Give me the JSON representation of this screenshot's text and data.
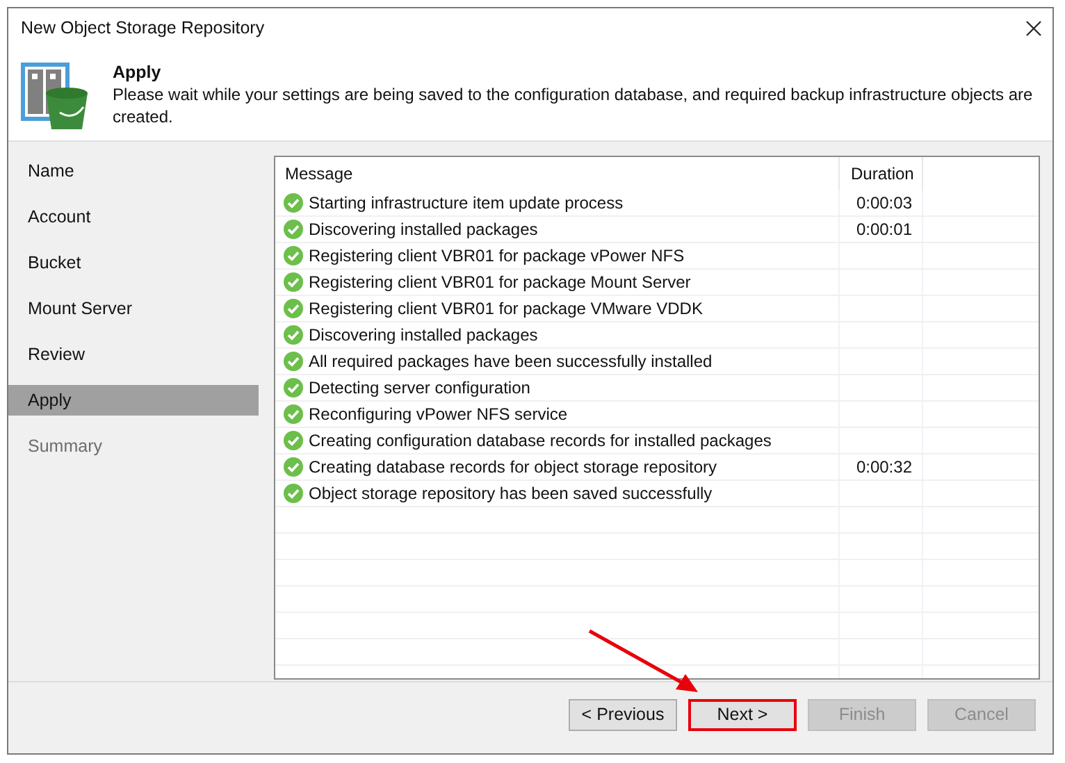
{
  "window": {
    "title": "New Object Storage Repository"
  },
  "header": {
    "title": "Apply",
    "description": "Please wait while your settings are being saved to the configuration database, and required backup infrastructure objects are created."
  },
  "steps": [
    {
      "label": "Name",
      "selected": false,
      "disabled": false
    },
    {
      "label": "Account",
      "selected": false,
      "disabled": false
    },
    {
      "label": "Bucket",
      "selected": false,
      "disabled": false
    },
    {
      "label": "Mount Server",
      "selected": false,
      "disabled": false
    },
    {
      "label": "Review",
      "selected": false,
      "disabled": false
    },
    {
      "label": "Apply",
      "selected": true,
      "disabled": false
    },
    {
      "label": "Summary",
      "selected": false,
      "disabled": true
    }
  ],
  "table": {
    "columns": [
      "Message",
      "Duration"
    ],
    "rows": [
      {
        "succeeded": true,
        "message": "Starting infrastructure item update process",
        "duration": "0:00:03"
      },
      {
        "succeeded": true,
        "message": "Discovering installed packages",
        "duration": "0:00:01"
      },
      {
        "succeeded": true,
        "message": "Registering client VBR01 for package vPower NFS"
      },
      {
        "succeeded": true,
        "message": "Registering client VBR01 for package Mount Server"
      },
      {
        "succeeded": true,
        "message": "Registering client VBR01 for package VMware VDDK"
      },
      {
        "succeeded": true,
        "message": "Discovering installed packages"
      },
      {
        "succeeded": true,
        "message": "All required packages have been successfully installed"
      },
      {
        "succeeded": true,
        "message": "Detecting server configuration"
      },
      {
        "succeeded": true,
        "message": "Reconfiguring vPower NFS service"
      },
      {
        "succeeded": true,
        "message": "Creating configuration database records for installed packages"
      },
      {
        "succeeded": true,
        "message": "Creating database records for object storage repository",
        "duration": "0:00:32"
      },
      {
        "succeeded": true,
        "message": "Object storage repository has been saved successfully"
      }
    ]
  },
  "buttons": [
    {
      "label": "< Previous",
      "disabled": false,
      "highlighted": false
    },
    {
      "label": "Next >",
      "disabled": false,
      "highlighted": true
    },
    {
      "label": "Finish",
      "disabled": true,
      "highlighted": false
    },
    {
      "label": "Cancel",
      "disabled": true,
      "highlighted": false
    }
  ]
}
